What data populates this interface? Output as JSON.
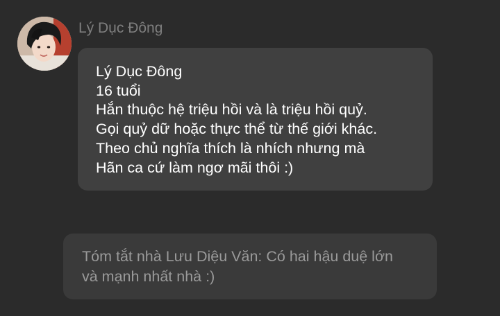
{
  "message": {
    "sender_name": "Lý Dục Đông",
    "lines": [
      "Lý Dục Đông",
      "16 tuổi",
      "Hắn thuộc hệ triệu hồi và là triệu hồi quỷ.",
      "Gọi quỷ dữ hoặc thực thể từ thế giới khác.",
      "Theo chủ nghĩa thích là nhích nhưng mà",
      "Hãn ca cứ làm ngơ mãi thôi :)"
    ]
  },
  "note": {
    "lines": [
      "Tóm tắt nhà Lưu Diệu Văn: Có hai hậu duệ lớn",
      "và mạnh nhất nhà :)"
    ]
  },
  "colors": {
    "background": "#2b2b2b",
    "bubble": "#404040",
    "note_bubble": "#3a3a3a",
    "sender_name": "#7e7e7e",
    "message_text": "#ffffff",
    "note_text": "#9a9a9a"
  },
  "icons": {
    "avatar": "profile-photo-avatar"
  }
}
